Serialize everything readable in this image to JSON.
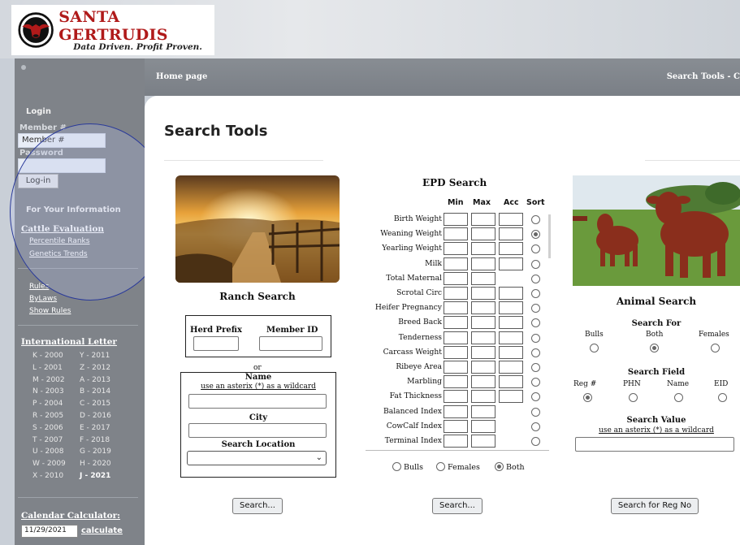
{
  "brand": {
    "name": "SANTA GERTRUDIS",
    "tagline": "Data Driven. Profit Proven."
  },
  "sidebar": {
    "login_label": "Login",
    "member_label": "Member #",
    "member_value": "Member #",
    "password_label": "Password",
    "login_button": "Log-in",
    "info_heading": "For Your Information",
    "cattle_eval_heading": "Cattle Evaluation",
    "cattle_eval_links": [
      "Percentile Ranks",
      "Genetics Trends"
    ],
    "rules_links": [
      "Rules",
      "ByLaws",
      "Show Rules"
    ],
    "intl_letter_heading": "International Letter",
    "letters": [
      [
        "K - 2000",
        "Y - 2011"
      ],
      [
        "L - 2001",
        "Z - 2012"
      ],
      [
        "M - 2002",
        "A - 2013"
      ],
      [
        "N - 2003",
        "B - 2014"
      ],
      [
        "P - 2004",
        "C - 2015"
      ],
      [
        "R - 2005",
        "D - 2016"
      ],
      [
        "S - 2006",
        "E - 2017"
      ],
      [
        "T - 2007",
        "F - 2018"
      ],
      [
        "U - 2008",
        "G - 2019"
      ],
      [
        "W - 2009",
        "H - 2020"
      ],
      [
        "X - 2010",
        "J - 2021"
      ]
    ],
    "calendar_heading": "Calendar Calculator:",
    "calendar_value": "11/29/2021",
    "calendar_link": "calculate"
  },
  "nav": {
    "home": "Home page",
    "right": "Search Tools - C"
  },
  "page_title": "Search Tools",
  "ranch": {
    "title": "Ranch Search",
    "herd_prefix_label": "Herd Prefix",
    "member_id_label": "Member ID",
    "or": "or",
    "name_label": "Name",
    "wildcard_hint": "use an asterix (*) as a wildcard",
    "city_label": "City",
    "location_label": "Search Location",
    "button": "Search..."
  },
  "epd": {
    "title": "EPD Search",
    "headers": [
      "Min",
      "Max",
      "Acc",
      "Sort"
    ],
    "rows": [
      {
        "label": "Birth Weight",
        "acc": true,
        "sorted": false
      },
      {
        "label": "Weaning Weight",
        "acc": true,
        "sorted": true
      },
      {
        "label": "Yearling Weight",
        "acc": true,
        "sorted": false
      },
      {
        "label": "Milk",
        "acc": true,
        "sorted": false
      },
      {
        "label": "Total Maternal",
        "acc": false,
        "sorted": false
      },
      {
        "label": "Scrotal Circ",
        "acc": true,
        "sorted": false
      },
      {
        "label": "Heifer Pregnancy",
        "acc": true,
        "sorted": false
      },
      {
        "label": "Breed Back",
        "acc": true,
        "sorted": false
      },
      {
        "label": "Tenderness",
        "acc": true,
        "sorted": false
      },
      {
        "label": "Carcass Weight",
        "acc": true,
        "sorted": false
      },
      {
        "label": "Ribeye Area",
        "acc": true,
        "sorted": false
      },
      {
        "label": "Marbling",
        "acc": true,
        "sorted": false
      },
      {
        "label": "Fat Thickness",
        "acc": true,
        "sorted": false
      },
      {
        "label": "Balanced Index",
        "acc": false,
        "sorted": false
      },
      {
        "label": "CowCalf Index",
        "acc": false,
        "sorted": false
      },
      {
        "label": "Terminal Index",
        "acc": false,
        "sorted": false
      }
    ],
    "sex_options": [
      "Bulls",
      "Females",
      "Both"
    ],
    "sex_selected": "Both",
    "button": "Search..."
  },
  "animal": {
    "title": "Animal Search",
    "search_for_label": "Search For",
    "search_for_options": [
      "Bulls",
      "Both",
      "Females"
    ],
    "search_for_selected": "Both",
    "search_field_label": "Search Field",
    "search_field_options": [
      "Reg #",
      "PHN",
      "Name",
      "EID"
    ],
    "search_field_selected": "Reg #",
    "search_value_label": "Search Value",
    "wildcard_hint": "use an asterix (*) as a wildcard",
    "button": "Search for Reg No"
  }
}
